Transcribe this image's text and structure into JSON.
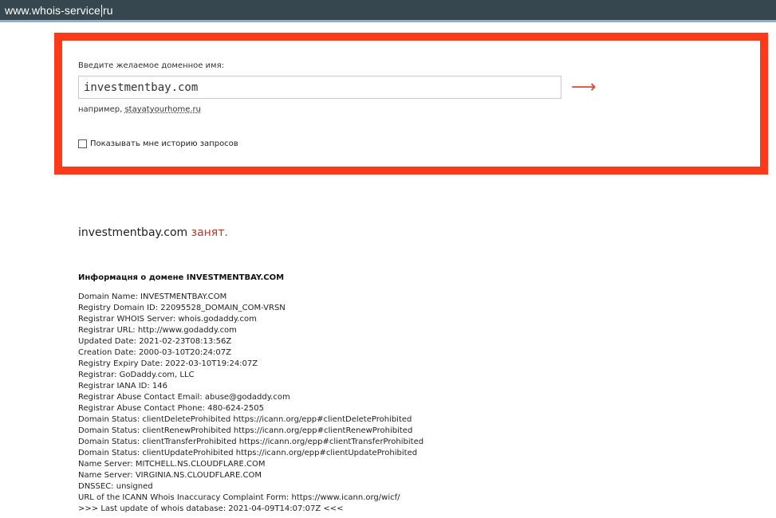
{
  "browser": {
    "url_before_caret": "www.whois-service",
    "url_after_caret": "ru"
  },
  "form": {
    "label": "Введите желаемое доменное имя:",
    "input_value": "investmentbay.com",
    "submit_glyph": "⟶",
    "example_prefix": "например,",
    "example_link": "stayatyourhome.ru",
    "history_label": "Показывать мне историю запросов",
    "history_checked": false
  },
  "result": {
    "domain": "investmentbay.com",
    "status": "занят."
  },
  "info": {
    "heading": "Информацня о домене INVESTMENTBAY.COM",
    "lines": [
      "Domain Name: INVESTMENTBAY.COM",
      "Registry Domain ID: 22095528_DOMAIN_COM-VRSN",
      "Registrar WHOIS Server: whois.godaddy.com",
      "Registrar URL: http://www.godaddy.com",
      "Updated Date: 2021-02-23T08:13:56Z",
      "Creation Date: 2000-03-10T20:24:07Z",
      "Registry Expiry Date: 2022-03-10T19:24:07Z",
      "Registrar: GoDaddy.com, LLC",
      "Registrar IANA ID: 146",
      "Registrar Abuse Contact Email: abuse@godaddy.com",
      "Registrar Abuse Contact Phone: 480-624-2505",
      "Domain Status: clientDeleteProhibited https://icann.org/epp#clientDeleteProhibited",
      "Domain Status: clientRenewProhibited https://icann.org/epp#clientRenewProhibited",
      "Domain Status: clientTransferProhibited https://icann.org/epp#clientTransferProhibited",
      "Domain Status: clientUpdateProhibited https://icann.org/epp#clientUpdateProhibited",
      "Name Server: MITCHELL.NS.CLOUDFLARE.COM",
      "Name Server: VIRGINIA.NS.CLOUDFLARE.COM",
      "DNSSEC: unsigned",
      "URL of the ICANN Whois Inaccuracy Complaint Form: https://www.icann.org/wicf/",
      ">>> Last update of whois database: 2021-04-09T14:07:07Z <<<"
    ]
  },
  "colors": {
    "highlight_border": "#fb3a19",
    "status_red": "#c8331f",
    "arrow": "#e3472f",
    "address_bar": "#36474f"
  }
}
